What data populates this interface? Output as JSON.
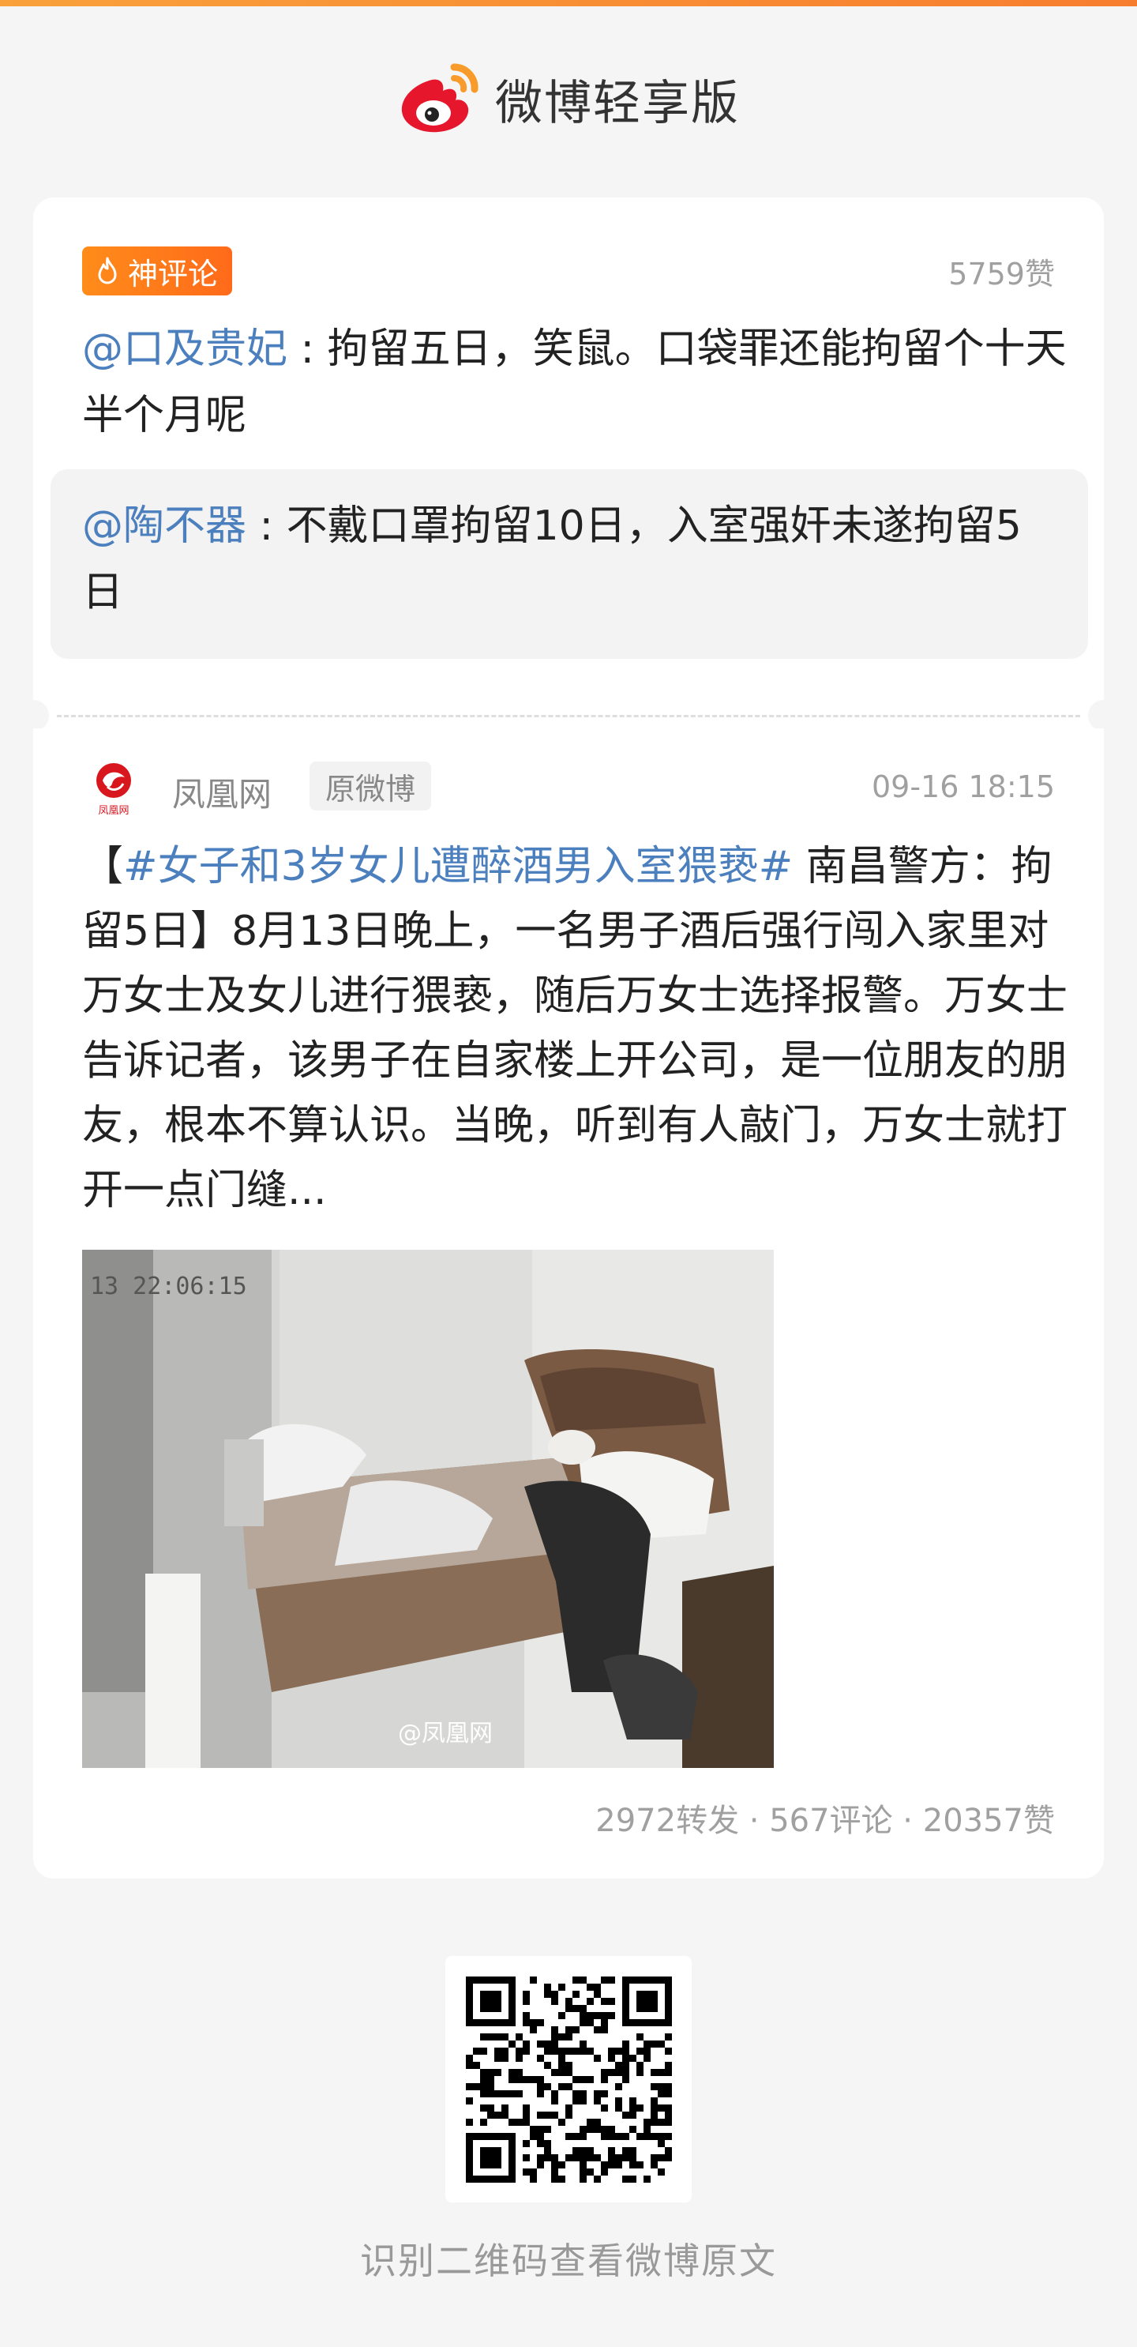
{
  "header": {
    "title": "微博轻享版",
    "brand_color": "#e6162d",
    "accent_color": "#f89b2a"
  },
  "hot_comment": {
    "badge_label": "神评论",
    "likes": "5759赞",
    "author": "@口及贵妃",
    "separator": " : ",
    "text": "拘留五日，笑鼠。口袋罪还能拘留个十天半个月呢",
    "reply": {
      "author": "@陶不器",
      "separator": " : ",
      "text": "不戴口罩拘留10日，入室强奸未遂拘留5日"
    }
  },
  "original_post": {
    "source_name": "凤凰网",
    "source_logo_text": "凤凰网",
    "tag": "原微博",
    "time": "09-16 18:15",
    "bracket_open": "【",
    "hashtag": "#女子和3岁女儿遭醉酒男入室猥亵#",
    "text": " 南昌警方：拘留5日】8月13日晚上，一名男子酒后强行闯入家里对万女士及女儿进行猥亵，随后万女士选择报警。万女士告诉记者，该男子在自家楼上开公司，是一位朋友的朋友，根本不算认识。当晚，听到有人敲门，万女士就打开一点门缝...",
    "image": {
      "timestamp": "13 22:06:15",
      "watermark": "@凤凰网"
    },
    "stats": {
      "reposts": "2972转发",
      "comments": "567评论",
      "likes": "20357赞",
      "dot": " · "
    }
  },
  "footer": {
    "qr_caption": "识别二维码查看微博原文"
  }
}
